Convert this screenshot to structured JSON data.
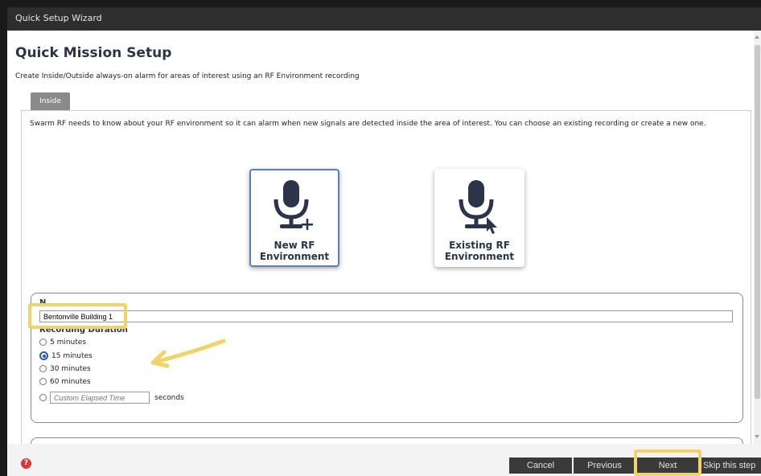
{
  "window": {
    "title": "Quick Setup Wizard"
  },
  "page": {
    "title": "Quick Mission Setup",
    "subtitle": "Create Inside/Outside always-on alarm for areas of interest using an RF Environment recording"
  },
  "tabs": [
    {
      "label": "Inside",
      "active": true
    }
  ],
  "intro_text": "Swarm RF needs to know about your RF environment so it can alarm when new signals are detected inside the area of interest. You can choose an existing recording or create a new one.",
  "options": {
    "new": {
      "label": "New RF\nEnvironment",
      "icon": "microphone-plus-icon",
      "selected": true
    },
    "existing": {
      "label": "Existing RF\nEnvironment",
      "icon": "microphone-cursor-icon",
      "selected": false
    }
  },
  "form": {
    "name_label": "N",
    "name_value": "Bentonville Building 1",
    "duration_label": "Recording Duration",
    "durations": [
      {
        "label": "5 minutes",
        "checked": false
      },
      {
        "label": "15 minutes",
        "checked": true
      },
      {
        "label": "30 minutes",
        "checked": false
      },
      {
        "label": "60 minutes",
        "checked": false
      }
    ],
    "custom_placeholder": "Custom Elapsed Time",
    "custom_unit": "seconds"
  },
  "footer": {
    "help_icon": "?",
    "cancel": "Cancel",
    "previous": "Previous",
    "next": "Next",
    "skip": "Skip this step"
  },
  "colors": {
    "heading": "#2b3448",
    "highlight": "#f1d36c",
    "arrow": "#f1d36c",
    "selected_border": "#5b7fb5",
    "radio_checked": "#1e5fbf",
    "button_bg": "#3a3a3a"
  }
}
